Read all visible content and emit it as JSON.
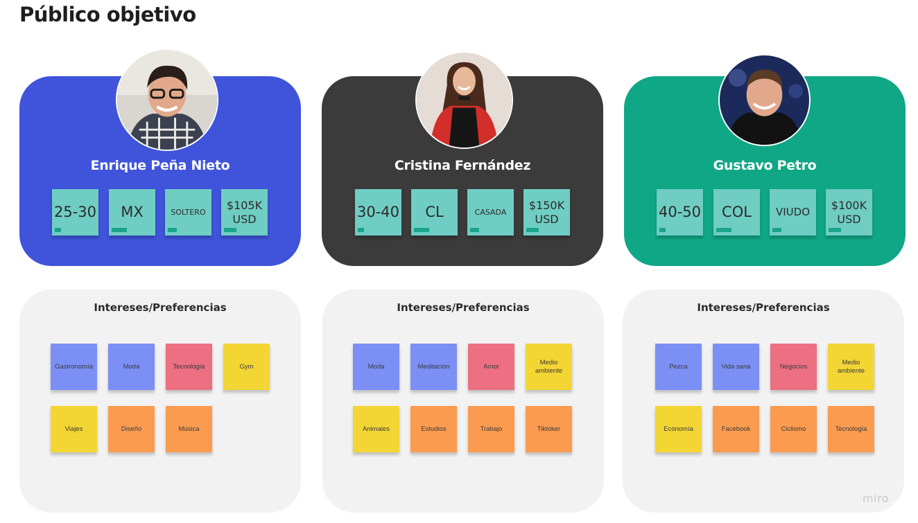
{
  "page": {
    "title": "Público objetivo"
  },
  "colors": {
    "blue_card": "#3f54da",
    "dark_card": "#3b3b3b",
    "green_card": "#10a786",
    "stat_note": "#6fcdc3",
    "sticky_blue": "#7b8ff5",
    "sticky_red": "#ec6f82",
    "sticky_yellow": "#f3d534",
    "sticky_orange": "#fb9b4f"
  },
  "personas": [
    {
      "name": "Enrique Peña Nieto",
      "avatar_icon": "man-glasses-photo",
      "stats": [
        {
          "value": "25-30",
          "size": "large"
        },
        {
          "value": "MX",
          "size": "large"
        },
        {
          "value": "SOLTERO",
          "size": "small"
        },
        {
          "value": "$105K USD",
          "size": "medium"
        }
      ],
      "interests_title": "Intereses/Preferencias",
      "interests": [
        {
          "label": "Gastronomía",
          "color": "blue"
        },
        {
          "label": "Moda",
          "color": "blue"
        },
        {
          "label": "Tecnología",
          "color": "red"
        },
        {
          "label": "Gym",
          "color": "yellow"
        },
        {
          "label": "Viajes",
          "color": "yellow"
        },
        {
          "label": "Diseño",
          "color": "orange"
        },
        {
          "label": "Música",
          "color": "orange"
        }
      ]
    },
    {
      "name": "Cristina Fernández",
      "avatar_icon": "woman-red-jacket-photo",
      "stats": [
        {
          "value": "30-40",
          "size": "large"
        },
        {
          "value": "CL",
          "size": "large"
        },
        {
          "value": "CASADA",
          "size": "small"
        },
        {
          "value": "$150K USD",
          "size": "medium"
        }
      ],
      "interests_title": "Intereses/Preferencias",
      "interests": [
        {
          "label": "Moda",
          "color": "blue"
        },
        {
          "label": "Meditación",
          "color": "blue"
        },
        {
          "label": "Amor",
          "color": "red"
        },
        {
          "label": "Medio ambiente",
          "color": "yellow"
        },
        {
          "label": "Animales",
          "color": "yellow"
        },
        {
          "label": "Estudios",
          "color": "orange"
        },
        {
          "label": "Trabajo",
          "color": "orange"
        },
        {
          "label": "Tiktoker",
          "color": "orange"
        }
      ]
    },
    {
      "name": "Gustavo Petro",
      "avatar_icon": "man-suit-photo",
      "stats": [
        {
          "value": "40-50",
          "size": "large"
        },
        {
          "value": "COL",
          "size": "large"
        },
        {
          "value": "VIUDO",
          "size": "mid"
        },
        {
          "value": "$100K USD",
          "size": "medium"
        }
      ],
      "interests_title": "Intereses/Preferencias",
      "interests": [
        {
          "label": "Pezca",
          "color": "blue"
        },
        {
          "label": "Vida sana",
          "color": "blue"
        },
        {
          "label": "Negocios",
          "color": "red"
        },
        {
          "label": "Medio ambiente",
          "color": "yellow"
        },
        {
          "label": "Economía",
          "color": "yellow"
        },
        {
          "label": "Facebook",
          "color": "orange"
        },
        {
          "label": "Ciclismo",
          "color": "orange"
        },
        {
          "label": "Tecnología",
          "color": "orange"
        }
      ]
    }
  ],
  "branding": {
    "logo_text": "miro"
  }
}
